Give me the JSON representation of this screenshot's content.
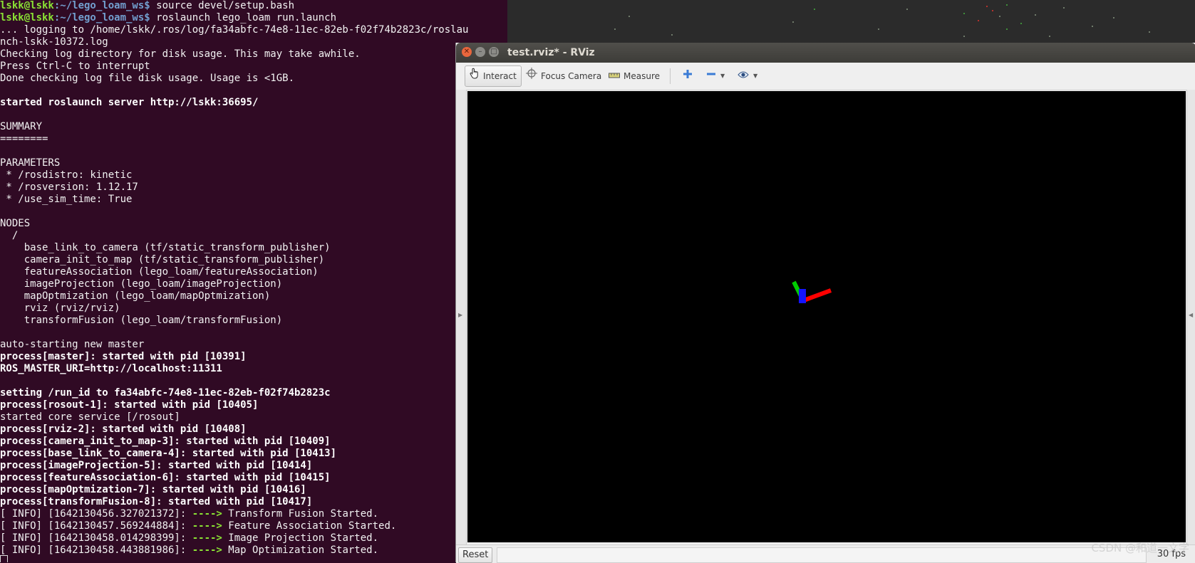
{
  "terminal": {
    "prompt_user": "lskk@lskk",
    "prompt_path": ":~/lego_loam_ws$ ",
    "cmd1": "source devel/setup.bash",
    "cmd2": "roslaunch lego_loam run.launch",
    "lines": [
      "... logging to /home/lskk/.ros/log/fa34abfc-74e8-11ec-82eb-f02f74b2823c/roslau",
      "nch-lskk-10372.log",
      "Checking log directory for disk usage. This may take awhile.",
      "Press Ctrl-C to interrupt",
      "Done checking log file disk usage. Usage is <1GB.",
      "",
      "started roslaunch server http://lskk:36695/",
      "",
      "SUMMARY",
      "========",
      "",
      "PARAMETERS",
      " * /rosdistro: kinetic",
      " * /rosversion: 1.12.17",
      " * /use_sim_time: True",
      "",
      "NODES",
      "  /",
      "    base_link_to_camera (tf/static_transform_publisher)",
      "    camera_init_to_map (tf/static_transform_publisher)",
      "    featureAssociation (lego_loam/featureAssociation)",
      "    imageProjection (lego_loam/imageProjection)",
      "    mapOptmization (lego_loam/mapOptmization)",
      "    rviz (rviz/rviz)",
      "    transformFusion (lego_loam/transformFusion)",
      "",
      "auto-starting new master",
      "process[master]: started with pid [10391]",
      "ROS_MASTER_URI=http://localhost:11311",
      "",
      "setting /run_id to fa34abfc-74e8-11ec-82eb-f02f74b2823c",
      "process[rosout-1]: started with pid [10405]",
      "started core service [/rosout]",
      "process[rviz-2]: started with pid [10408]",
      "process[camera_init_to_map-3]: started with pid [10409]",
      "process[base_link_to_camera-4]: started with pid [10413]",
      "process[imageProjection-5]: started with pid [10414]",
      "process[featureAssociation-6]: started with pid [10415]",
      "process[mapOptmization-7]: started with pid [10416]",
      "process[transformFusion-8]: started with pid [10417]"
    ],
    "bold_lines": [
      6,
      27,
      28,
      30,
      31,
      33,
      34,
      35,
      36,
      37,
      38,
      39
    ],
    "info_lines": [
      {
        "prefix": "[ INFO] [1642130456.327021372]: ",
        "arrow": "---->",
        "msg": " Transform Fusion Started."
      },
      {
        "prefix": "[ INFO] [1642130457.569244884]: ",
        "arrow": "---->",
        "msg": " Feature Association Started."
      },
      {
        "prefix": "[ INFO] [1642130458.014298399]: ",
        "arrow": "---->",
        "msg": " Image Projection Started."
      },
      {
        "prefix": "[ INFO] [1642130458.443881986]: ",
        "arrow": "---->",
        "msg": " Map Optimization Started."
      }
    ]
  },
  "rviz": {
    "title": "test.rviz* - RViz",
    "toolbar": {
      "interact": "Interact",
      "focus_camera": "Focus Camera",
      "measure": "Measure"
    },
    "status": {
      "reset": "Reset",
      "fps": "30 fps"
    }
  },
  "watermark": "CSDN @和道一文字",
  "colors": {
    "terminal_bg": "#300a24",
    "prompt_user": "#8ae234",
    "prompt_path": "#729fcf",
    "axis_x": "#ff0000",
    "axis_y": "#00cc00",
    "axis_z": "#0000ff"
  },
  "icons": {
    "interact": "hand-pointer-icon",
    "focus_camera": "crosshair-icon",
    "measure": "ruler-icon",
    "add": "plus-icon",
    "remove": "minus-icon",
    "view": "eye-icon"
  }
}
